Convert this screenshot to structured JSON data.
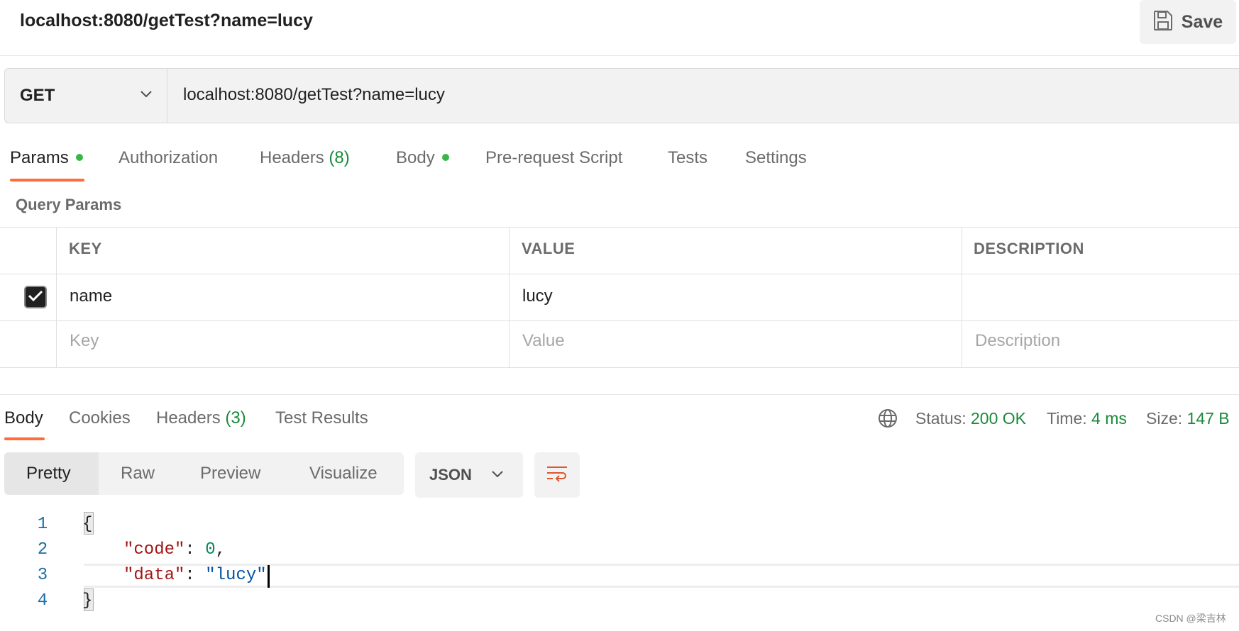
{
  "header": {
    "title": "localhost:8080/getTest?name=lucy",
    "save_label": "Save"
  },
  "request": {
    "method": "GET",
    "url": "localhost:8080/getTest?name=lucy"
  },
  "request_tabs": {
    "params": "Params",
    "authorization": "Authorization",
    "headers": "Headers",
    "headers_count": "(8)",
    "body": "Body",
    "pre_request": "Pre-request Script",
    "tests": "Tests",
    "settings": "Settings"
  },
  "query_params": {
    "title": "Query Params",
    "columns": [
      "KEY",
      "VALUE",
      "DESCRIPTION"
    ],
    "rows": [
      {
        "checked": true,
        "key": "name",
        "value": "lucy",
        "description": ""
      }
    ],
    "placeholders": {
      "key": "Key",
      "value": "Value",
      "description": "Description"
    }
  },
  "response_tabs": {
    "body": "Body",
    "cookies": "Cookies",
    "headers": "Headers",
    "headers_count": "(3)",
    "test_results": "Test Results"
  },
  "status": {
    "status_label": "Status:",
    "status_value": "200 OK",
    "time_label": "Time:",
    "time_value": "4 ms",
    "size_label": "Size:",
    "size_value": "147 B"
  },
  "view_modes": {
    "pretty": "Pretty",
    "raw": "Raw",
    "preview": "Preview",
    "visualize": "Visualize",
    "active": "Pretty"
  },
  "format": "JSON",
  "code": {
    "line_numbers": [
      "1",
      "2",
      "3",
      "4"
    ],
    "open_brace": "{",
    "close_brace": "}",
    "line2": {
      "key": "\"code\"",
      "sep": ": ",
      "value": "0",
      "trail": ","
    },
    "line3": {
      "key": "\"data\"",
      "sep": ": ",
      "value": "\"lucy\""
    }
  },
  "watermark": "CSDN @梁吉林",
  "icons": {
    "save": "floppy-disk-icon",
    "method_chevron": "chevron-down-icon",
    "globe": "globe-icon",
    "format_chevron": "chevron-down-icon",
    "wrap": "text-wrap-icon",
    "checkbox": "checkmark-icon"
  },
  "colors": {
    "accent": "#ff6c37",
    "success": "#1a8a3a",
    "dot": "#3ab54a"
  }
}
